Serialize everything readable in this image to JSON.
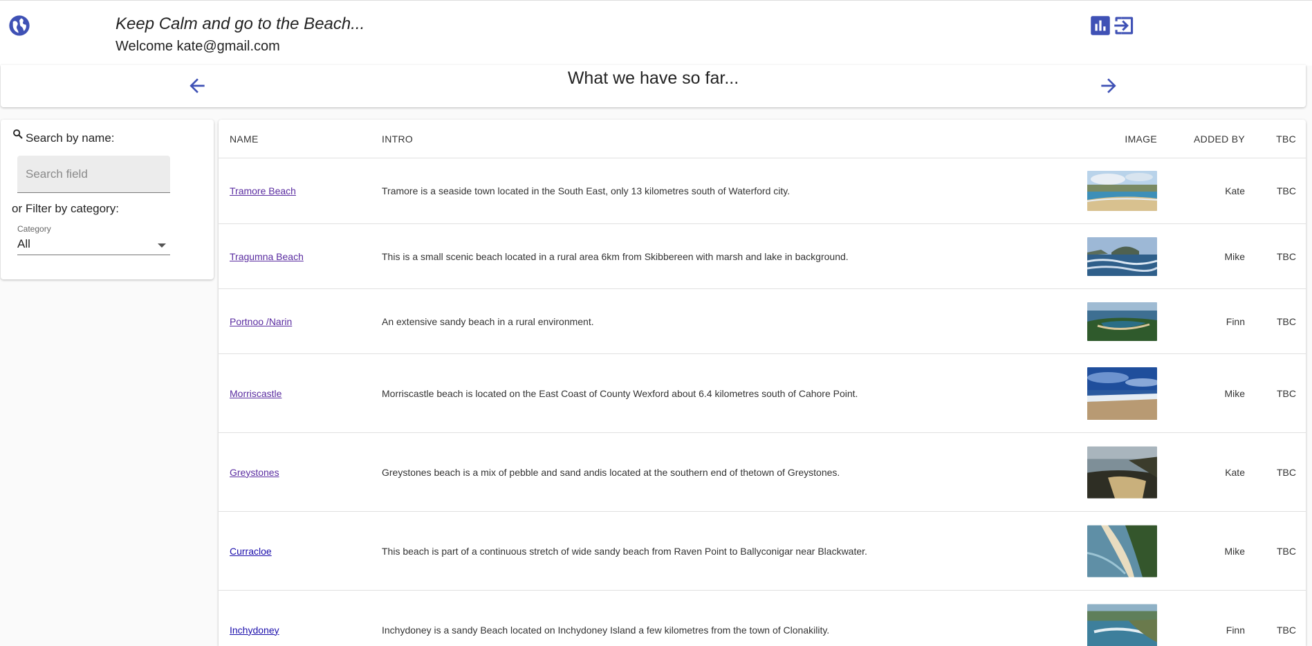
{
  "header": {
    "title": "Keep Calm and go to the Beach...",
    "welcome": "Welcome kate@gmail.com",
    "accent_color": "#3f51b5",
    "icons": [
      "globe-icon",
      "bar-chart-icon",
      "logout-icon"
    ]
  },
  "nav": {
    "title": "What we have so far...",
    "prev_icon": "arrow-left-icon",
    "next_icon": "arrow-right-icon"
  },
  "sidebar": {
    "search_label": "Search by name:",
    "search_placeholder": "Search field",
    "search_value": "",
    "filter_label": "or Filter by category:",
    "category_label": "Category",
    "category_value": "All"
  },
  "table": {
    "headers": {
      "name": "NAME",
      "intro": "INTRO",
      "image": "IMAGE",
      "added_by": "ADDED BY",
      "tbc": "TBC"
    },
    "rows": [
      {
        "name": "Tramore Beach",
        "intro": "Tramore is a seaside town located in the South East, only 13 kilometres south of Waterford city.",
        "added_by": "Kate",
        "tbc": "TBC",
        "visited": true
      },
      {
        "name": "Tragumna Beach",
        "intro": "This is a small scenic beach located in a rural area 6km from Skibbereen with marsh and lake in background.",
        "added_by": "Mike",
        "tbc": "TBC",
        "visited": true
      },
      {
        "name": "Portnoo /Narin",
        "intro": "An extensive sandy beach in a rural environment.",
        "added_by": "Finn",
        "tbc": "TBC",
        "visited": true
      },
      {
        "name": "Morriscastle",
        "intro": "Morriscastle beach is located on the East Coast of County Wexford about 6.4 kilometres south of Cahore Point.",
        "added_by": "Mike",
        "tbc": "TBC",
        "visited": true
      },
      {
        "name": "Greystones",
        "intro": "Greystones beach is a mix of pebble and sand andis located at the southern end of thetown of Greystones.",
        "added_by": "Kate",
        "tbc": "TBC",
        "visited": true
      },
      {
        "name": "Curracloe",
        "intro": "This beach is part of a continuous stretch of wide sandy beach from Raven Point to Ballyconigar near Blackwater.",
        "added_by": "Mike",
        "tbc": "TBC",
        "visited": false
      },
      {
        "name": "Inchydoney",
        "intro": "Inchydoney is a sandy Beach located on Inchydoney Island a few kilometres from the town of Clonakility.",
        "added_by": "Finn",
        "tbc": "TBC",
        "visited": false
      }
    ]
  }
}
